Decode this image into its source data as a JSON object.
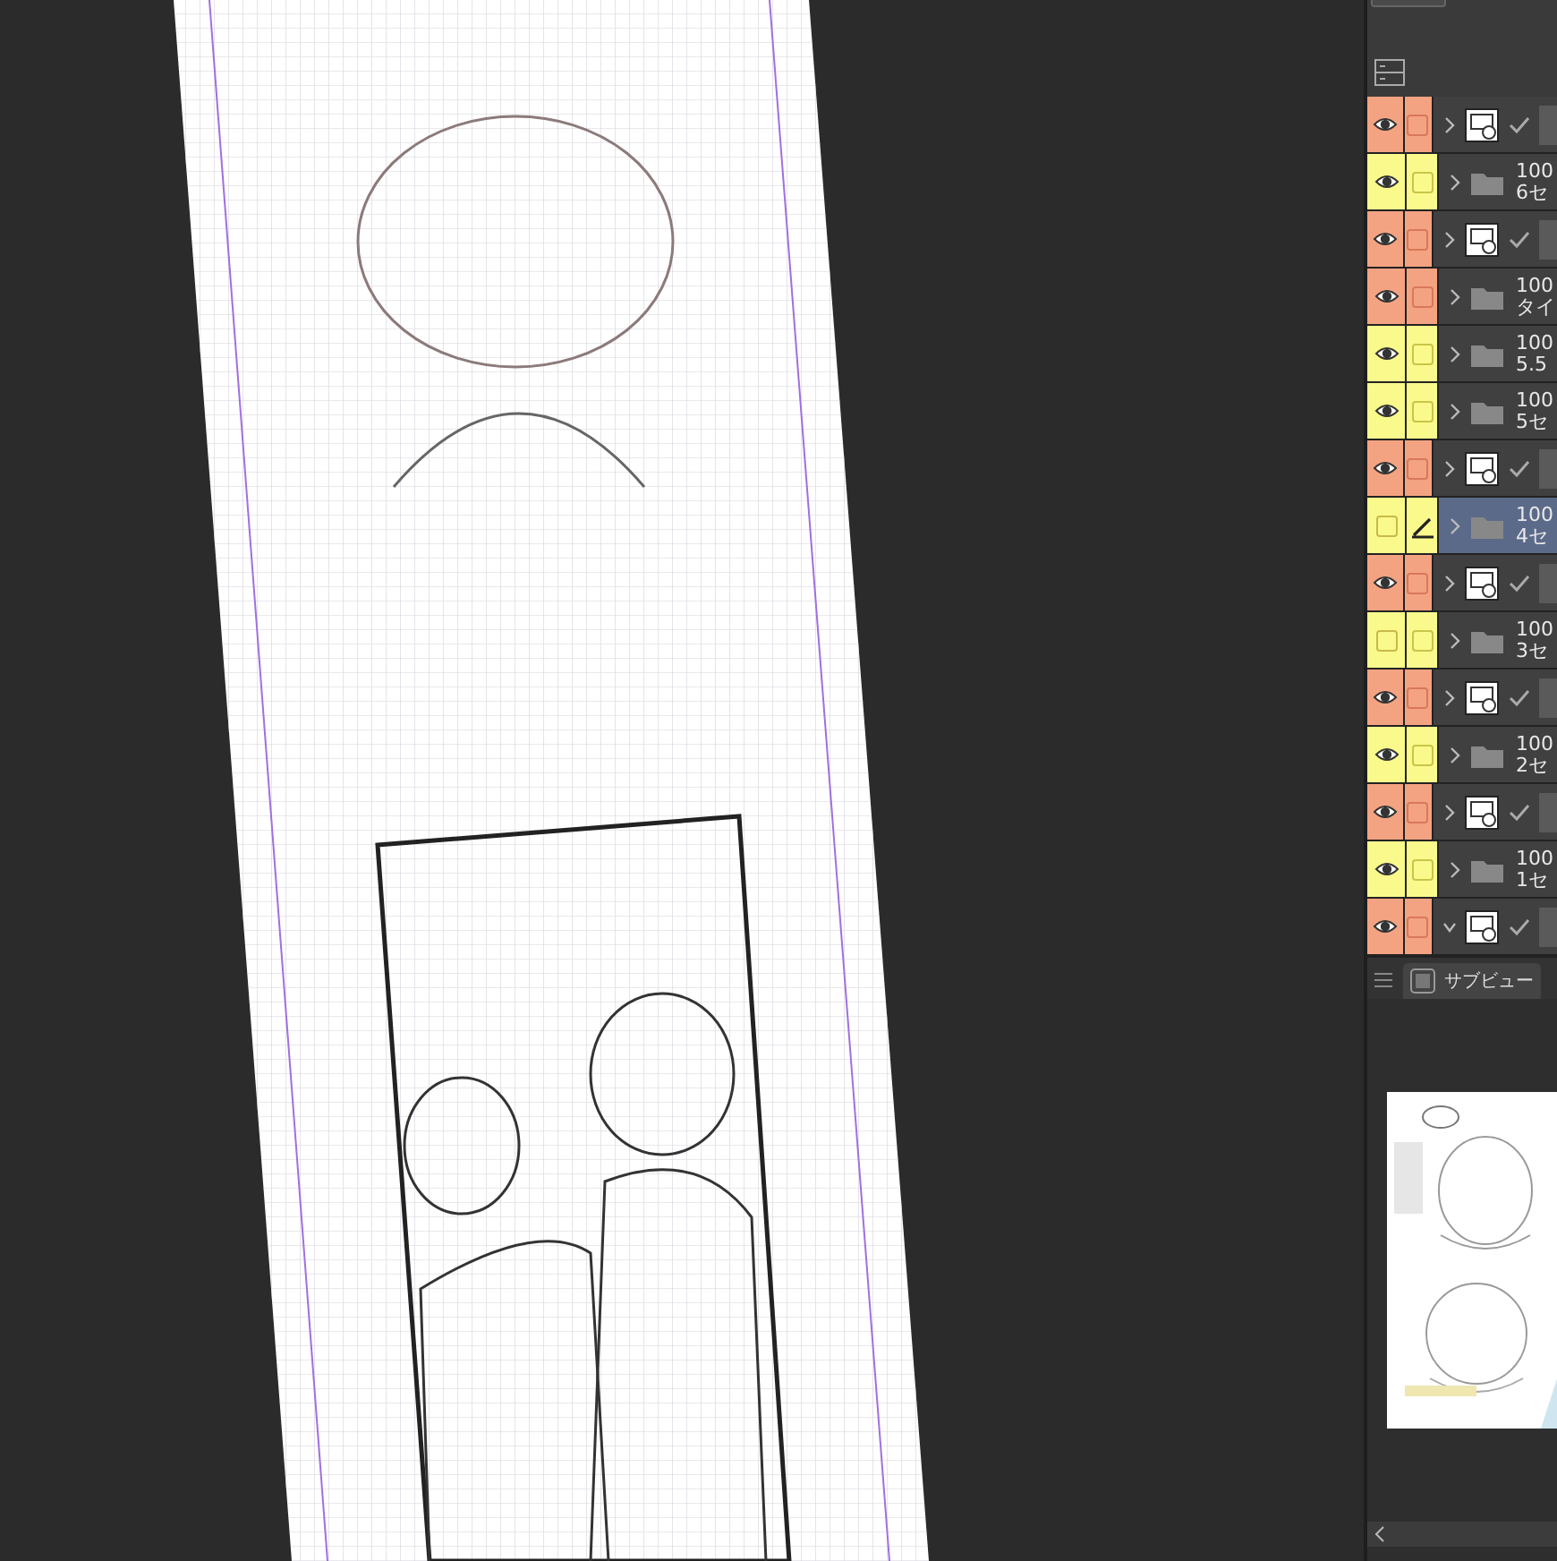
{
  "layers": [
    {
      "kind": "raster",
      "visible": true,
      "editing": false,
      "selected": false,
      "expanded": false,
      "color": "#f4a382"
    },
    {
      "kind": "folder",
      "line1": "100",
      "line2": "6セ",
      "visible": true,
      "editing": false,
      "selected": false,
      "expanded": false,
      "color": "#fafa8c"
    },
    {
      "kind": "raster",
      "visible": true,
      "editing": false,
      "selected": false,
      "expanded": false,
      "color": "#f4a382"
    },
    {
      "kind": "folder",
      "line1": "100",
      "line2": "タイ",
      "visible": true,
      "editing": false,
      "selected": false,
      "expanded": false,
      "color": "#f4a382"
    },
    {
      "kind": "folder",
      "line1": "100",
      "line2": "5.5",
      "visible": true,
      "editing": false,
      "selected": false,
      "expanded": false,
      "color": "#fafa8c"
    },
    {
      "kind": "folder",
      "line1": "100",
      "line2": "5セ",
      "visible": true,
      "editing": false,
      "selected": false,
      "expanded": false,
      "color": "#fafa8c"
    },
    {
      "kind": "raster",
      "visible": true,
      "editing": false,
      "selected": false,
      "expanded": false,
      "color": "#f4a382"
    },
    {
      "kind": "folder",
      "line1": "100",
      "line2": "4セ",
      "visible": false,
      "editing": true,
      "selected": true,
      "expanded": false,
      "color": "#fafa8c"
    },
    {
      "kind": "raster",
      "visible": true,
      "editing": false,
      "selected": false,
      "expanded": false,
      "color": "#f4a382"
    },
    {
      "kind": "folder",
      "line1": "100",
      "line2": "3セ",
      "visible": false,
      "editing": false,
      "selected": false,
      "expanded": false,
      "color": "#fafa8c"
    },
    {
      "kind": "raster",
      "visible": true,
      "editing": false,
      "selected": false,
      "expanded": false,
      "color": "#f4a382"
    },
    {
      "kind": "folder",
      "line1": "100",
      "line2": "2セ",
      "visible": true,
      "editing": false,
      "selected": false,
      "expanded": false,
      "color": "#fafa8c"
    },
    {
      "kind": "raster",
      "visible": true,
      "editing": false,
      "selected": false,
      "expanded": false,
      "color": "#f4a382"
    },
    {
      "kind": "folder",
      "line1": "100",
      "line2": "1セ",
      "visible": true,
      "editing": false,
      "selected": false,
      "expanded": false,
      "color": "#fafa8c"
    },
    {
      "kind": "raster",
      "visible": true,
      "editing": false,
      "selected": false,
      "expanded": true,
      "color": "#f4a382"
    }
  ],
  "subview": {
    "tab": "サブビュー"
  }
}
